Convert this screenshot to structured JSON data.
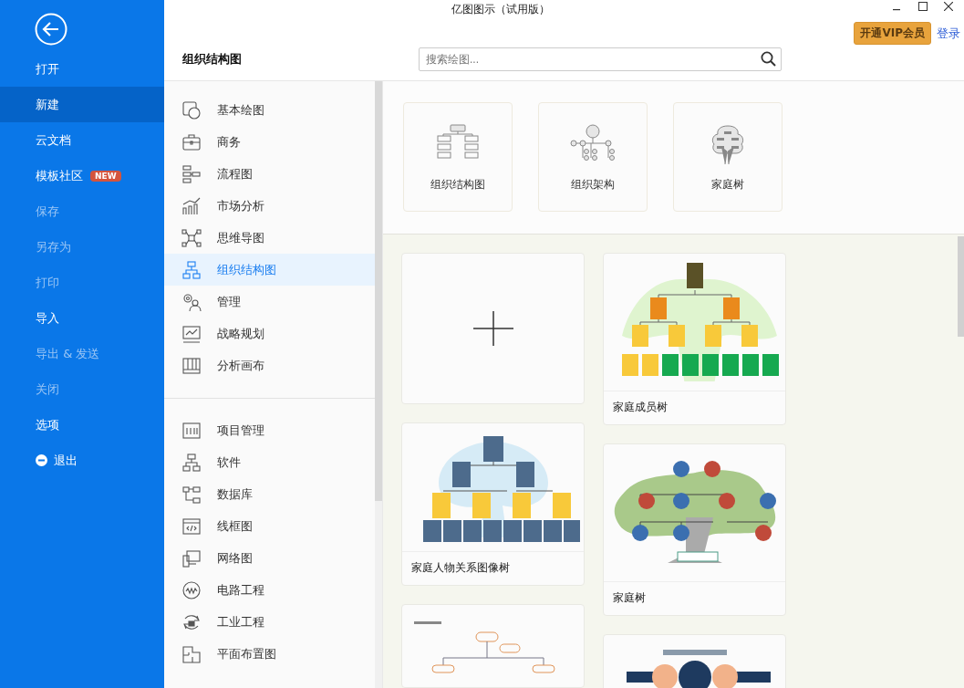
{
  "window": {
    "title": "亿图图示（试用版）"
  },
  "sidebar": {
    "items": [
      {
        "label": "打开",
        "kind": "plain",
        "selected": false,
        "disabled": false
      },
      {
        "label": "新建",
        "kind": "plain",
        "selected": true,
        "disabled": false
      },
      {
        "label": "云文档",
        "kind": "plain",
        "selected": false,
        "disabled": false
      },
      {
        "label": "模板社区",
        "kind": "plain",
        "selected": false,
        "disabled": false,
        "badge": "NEW"
      },
      {
        "label": "保存",
        "kind": "plain",
        "selected": false,
        "disabled": true
      },
      {
        "label": "另存为",
        "kind": "plain",
        "selected": false,
        "disabled": true
      },
      {
        "label": "打印",
        "kind": "plain",
        "selected": false,
        "disabled": true
      },
      {
        "label": "导入",
        "kind": "plain",
        "selected": false,
        "disabled": false
      },
      {
        "label": "导出 & 发送",
        "kind": "plain",
        "selected": false,
        "disabled": true
      },
      {
        "label": "关闭",
        "kind": "plain",
        "selected": false,
        "disabled": true
      },
      {
        "label": "选项",
        "kind": "plain",
        "selected": false,
        "disabled": false
      },
      {
        "label": "退出",
        "kind": "exit",
        "selected": false,
        "disabled": false
      }
    ]
  },
  "header": {
    "vip_button": "开通VIP会员",
    "login_link": "登录",
    "heading": "组织结构图",
    "search": {
      "placeholder": "搜索绘图..."
    }
  },
  "categories": [
    [
      {
        "label": "基本绘图",
        "kind": "basic",
        "selected": false
      },
      {
        "label": "商务",
        "kind": "business",
        "selected": false
      },
      {
        "label": "流程图",
        "kind": "flow",
        "selected": false
      },
      {
        "label": "市场分析",
        "kind": "market",
        "selected": false
      },
      {
        "label": "思维导图",
        "kind": "mind",
        "selected": false
      },
      {
        "label": "组织结构图",
        "kind": "org",
        "selected": true
      },
      {
        "label": "管理",
        "kind": "manage",
        "selected": false
      },
      {
        "label": "战略规划",
        "kind": "strategy",
        "selected": false
      },
      {
        "label": "分析画布",
        "kind": "canvas",
        "selected": false
      }
    ],
    [
      {
        "label": "项目管理",
        "kind": "project",
        "selected": false
      },
      {
        "label": "软件",
        "kind": "org",
        "selected": false
      },
      {
        "label": "数据库",
        "kind": "database",
        "selected": false
      },
      {
        "label": "线框图",
        "kind": "wireframe",
        "selected": false
      },
      {
        "label": "网络图",
        "kind": "network",
        "selected": false
      },
      {
        "label": "电路工程",
        "kind": "circuit",
        "selected": false
      },
      {
        "label": "工业工程",
        "kind": "industry",
        "selected": false
      },
      {
        "label": "平面布置图",
        "kind": "floor",
        "selected": false
      }
    ]
  ],
  "quick_templates": [
    {
      "label": "组织结构图",
      "kind": "org-chart"
    },
    {
      "label": "组织架构",
      "kind": "org-structure"
    },
    {
      "label": "家庭树",
      "kind": "tree"
    }
  ],
  "templates": [
    {
      "kind": "blank"
    },
    {
      "kind": "member-tree",
      "label": "家庭成员树"
    },
    {
      "kind": "portrait-tree",
      "label": "家庭人物关系图像树"
    },
    {
      "kind": "avatar-tree",
      "label": "家庭树"
    },
    {
      "kind": "safety-chart"
    },
    {
      "kind": "management-chart"
    }
  ]
}
